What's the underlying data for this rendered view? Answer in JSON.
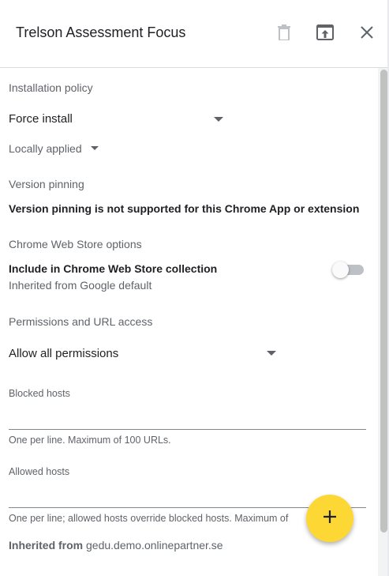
{
  "header": {
    "title": "Trelson Assessment Focus"
  },
  "installation_policy": {
    "label": "Installation policy",
    "value": "Force install",
    "scope": "Locally applied"
  },
  "version_pinning": {
    "label": "Version pinning",
    "message": "Version pinning is not supported for this Chrome App or extension"
  },
  "web_store": {
    "label": "Chrome Web Store options",
    "include_label": "Include in Chrome Web Store collection",
    "inherited": "Inherited from Google default",
    "toggle_on": false
  },
  "permissions": {
    "label": "Permissions and URL access",
    "value": "Allow all permissions"
  },
  "blocked_hosts": {
    "label": "Blocked hosts",
    "value": "",
    "helper": "One per line. Maximum of 100 URLs."
  },
  "allowed_hosts": {
    "label": "Allowed hosts",
    "value": "",
    "helper": "One per line; allowed hosts override blocked hosts. Maximum of"
  },
  "inherited": {
    "prefix": "Inherited from",
    "source": "gedu.demo.onlinepartner.se"
  },
  "colors": {
    "fab": "#fdd835",
    "text": "#202124",
    "muted": "#5f6368"
  },
  "icons": {
    "delete": "trash-icon",
    "open": "open-in-new-icon",
    "close": "close-icon",
    "add": "plus-icon"
  }
}
